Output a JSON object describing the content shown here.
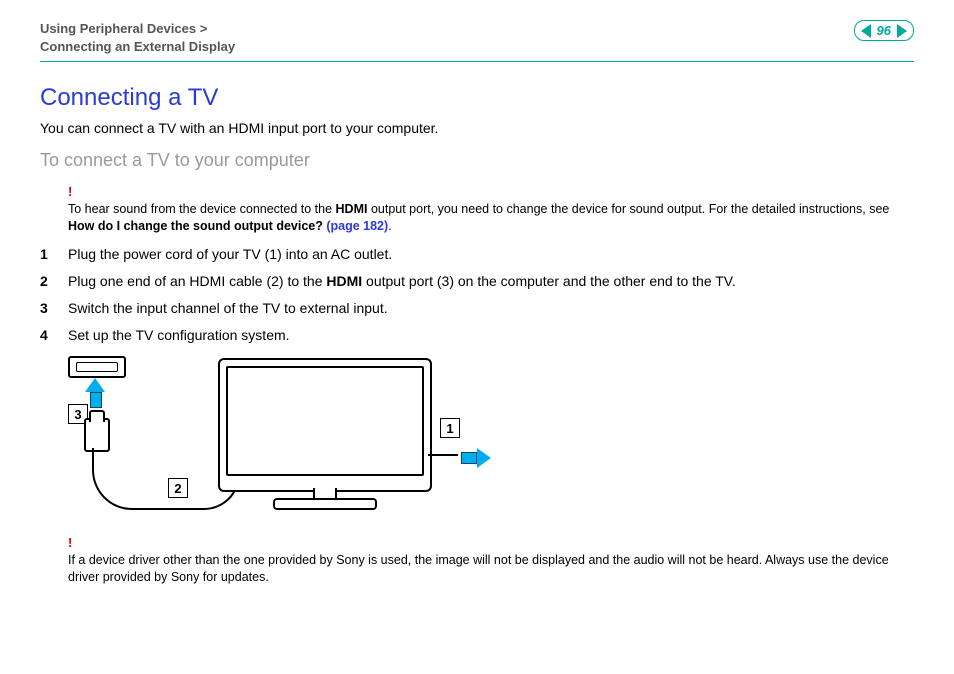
{
  "header": {
    "breadcrumb1": "Using Peripheral Devices",
    "sep": ">",
    "breadcrumb2": "Connecting an External Display",
    "page_number": "96",
    "prev_icon": "prev-page",
    "next_icon": "next-page"
  },
  "title": "Connecting a TV",
  "intro": "You can connect a TV with an HDMI input port to your computer.",
  "subtitle": "To connect a TV to your computer",
  "note1": {
    "bang": "!",
    "text_a": "To hear sound from the device connected to the ",
    "hdmi": "HDMI",
    "text_b": " output port, you need to change the device for sound output. For the detailed instructions, see ",
    "bold": "How do I change the sound output device? ",
    "link": "(page 182)",
    "text_c": "."
  },
  "steps": [
    {
      "n": "1",
      "text_a": "Plug the power cord of your TV (1) into an AC outlet."
    },
    {
      "n": "2",
      "text_a": "Plug one end of an HDMI cable (2) to the ",
      "bold": "HDMI",
      "text_b": " output port (3) on the computer and the other end to the TV."
    },
    {
      "n": "3",
      "text_a": "Switch the input channel of the TV to external input."
    },
    {
      "n": "4",
      "text_a": "Set up the TV configuration system."
    }
  ],
  "diagram": {
    "label1": "1",
    "label2": "2",
    "label3": "3"
  },
  "note2": {
    "bang": "!",
    "text": "If a device driver other than the one provided by Sony is used, the image will not be displayed and the audio will not be heard. Always use the device driver provided by Sony for updates."
  }
}
